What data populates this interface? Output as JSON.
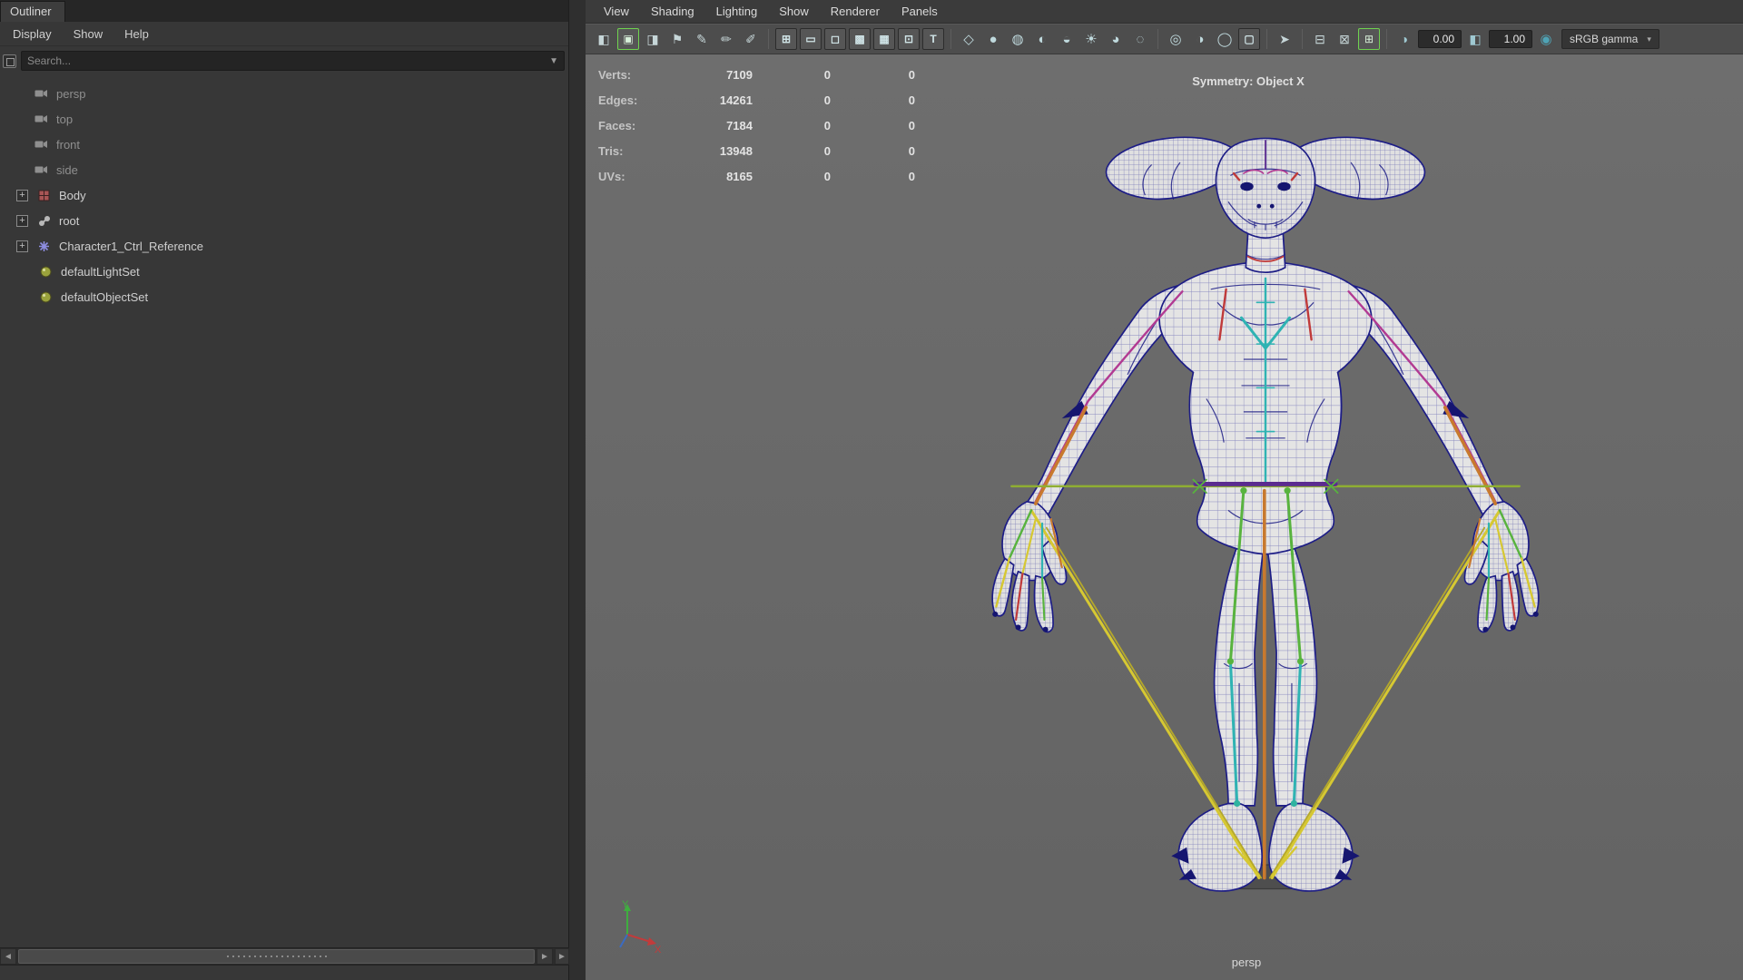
{
  "outliner": {
    "tab_title": "Outliner",
    "menus": [
      "Display",
      "Show",
      "Help"
    ],
    "search_placeholder": "Search...",
    "items": [
      {
        "label": "persp",
        "icon": "camera-icon",
        "type": "camera",
        "dim": true
      },
      {
        "label": "top",
        "icon": "camera-icon",
        "type": "camera",
        "dim": true
      },
      {
        "label": "front",
        "icon": "camera-icon",
        "type": "camera",
        "dim": true
      },
      {
        "label": "side",
        "icon": "camera-icon",
        "type": "camera",
        "dim": true
      },
      {
        "label": "Body",
        "icon": "mesh-icon",
        "type": "node",
        "expandable": true
      },
      {
        "label": "root",
        "icon": "joint-icon",
        "type": "node",
        "expandable": true
      },
      {
        "label": "Character1_Ctrl_Reference",
        "icon": "reference-icon",
        "type": "node",
        "expandable": true
      },
      {
        "label": "defaultLightSet",
        "icon": "set-icon",
        "type": "set"
      },
      {
        "label": "defaultObjectSet",
        "icon": "set-icon",
        "type": "set"
      }
    ]
  },
  "viewport": {
    "menus": [
      "View",
      "Shading",
      "Lighting",
      "Show",
      "Renderer",
      "Panels"
    ],
    "symmetry_label": "Symmetry: Object X",
    "camera_label": "persp",
    "axis": {
      "x": "X",
      "y": "Y"
    },
    "hud_rows": [
      {
        "label": "Verts:",
        "v1": "7109",
        "v2": "0",
        "v3": "0"
      },
      {
        "label": "Edges:",
        "v1": "14261",
        "v2": "0",
        "v3": "0"
      },
      {
        "label": "Faces:",
        "v1": "7184",
        "v2": "0",
        "v3": "0"
      },
      {
        "label": "Tris:",
        "v1": "13948",
        "v2": "0",
        "v3": "0"
      },
      {
        "label": "UVs:",
        "v1": "8165",
        "v2": "0",
        "v3": "0"
      }
    ]
  },
  "toolbar": {
    "items": [
      {
        "name": "choose-camera-icon",
        "glyph": "◧",
        "style": "plain"
      },
      {
        "name": "camera-highlight-icon",
        "glyph": "▣",
        "style": "active"
      },
      {
        "name": "camera-attributes-icon",
        "glyph": "◨",
        "style": "plain"
      },
      {
        "name": "bookmark-icon",
        "glyph": "⚑",
        "style": "plain"
      },
      {
        "name": "grease-pencil-icon",
        "glyph": "✎",
        "style": "plain"
      },
      {
        "name": "grease-pencil-frames-icon",
        "glyph": "✏",
        "style": "plain"
      },
      {
        "name": "grease-pencil-settings-icon",
        "glyph": "✐",
        "style": "plain"
      },
      {
        "style": "sep"
      },
      {
        "name": "grid-icon",
        "glyph": "⊞",
        "style": "boxed"
      },
      {
        "name": "film-gate-icon",
        "glyph": "▭",
        "style": "boxed"
      },
      {
        "name": "resolution-gate-icon",
        "glyph": "◻",
        "style": "boxed"
      },
      {
        "name": "gate-mask-icon",
        "glyph": "▩",
        "style": "boxed"
      },
      {
        "name": "field-chart-icon",
        "glyph": "▦",
        "style": "boxed"
      },
      {
        "name": "safe-action-icon",
        "glyph": "⊡",
        "style": "boxed"
      },
      {
        "name": "safe-title-icon",
        "glyph": "T",
        "style": "boxed"
      },
      {
        "style": "sep"
      },
      {
        "name": "wireframe-icon",
        "glyph": "◇",
        "style": "sphere"
      },
      {
        "name": "smooth-shade-icon",
        "glyph": "●",
        "style": "sphere"
      },
      {
        "name": "wireframe-on-shaded-icon",
        "glyph": "◍",
        "style": "sphere"
      },
      {
        "name": "textured-icon",
        "glyph": "◐",
        "style": "sphere"
      },
      {
        "name": "use-default-material-icon",
        "glyph": "◒",
        "style": "sphere"
      },
      {
        "name": "shadows-icon",
        "glyph": "☀",
        "style": "sphere"
      },
      {
        "name": "ambient-occlusion-icon",
        "glyph": "◕",
        "style": "sphere"
      },
      {
        "name": "motion-blur-icon",
        "glyph": "◌",
        "style": "sphere"
      },
      {
        "style": "sep"
      },
      {
        "name": "lights-icon",
        "glyph": "◎",
        "style": "sphere"
      },
      {
        "name": "two-sided-lighting-icon",
        "glyph": "◑",
        "style": "sphere"
      },
      {
        "name": "texture-placement-icon",
        "glyph": "◯",
        "style": "sphere"
      },
      {
        "name": "viewport-renderer-icon",
        "glyph": "▢",
        "style": "boxed"
      },
      {
        "style": "sep"
      },
      {
        "name": "select-tool-icon",
        "glyph": "➤",
        "style": "plain"
      },
      {
        "style": "sep"
      },
      {
        "name": "tear-off-copy-icon",
        "glyph": "⊟",
        "style": "plain"
      },
      {
        "name": "tear-off-icon",
        "glyph": "⊠",
        "style": "plain"
      },
      {
        "name": "multi-pane-icon",
        "glyph": "⊞",
        "style": "active"
      },
      {
        "style": "sep"
      },
      {
        "name": "exposure-icon",
        "glyph": "◑",
        "style": "round"
      },
      {
        "name": "exposure-field",
        "value": "0.00",
        "style": "field"
      },
      {
        "name": "gamma-icon",
        "glyph": "◧",
        "style": "round"
      },
      {
        "name": "gamma-field",
        "value": "1.00",
        "style": "field"
      },
      {
        "name": "color-management-icon",
        "glyph": "◉",
        "style": "round-active"
      },
      {
        "name": "colorspace-dropdown",
        "value": "sRGB gamma",
        "style": "dropdown"
      }
    ]
  },
  "colors": {
    "panel_bg": "#373737",
    "panel_dark": "#262626",
    "toolbar_bg": "#4d4d4d",
    "menubar_bg": "#3b3b3b",
    "viewport_bg": "#6a6a6a",
    "accent_teal": "#4fa3b5",
    "wireframe_navy": "#1d1d86",
    "rig_yellow": "#d6c832",
    "rig_green": "#58b33e",
    "rig_orange": "#c8792e",
    "rig_teal": "#2fb3b3",
    "rig_magenta": "#b23a92",
    "rig_red": "#c03a3a",
    "rig_purple": "#5b2b8f",
    "hud_text": "#d9d9d9"
  }
}
